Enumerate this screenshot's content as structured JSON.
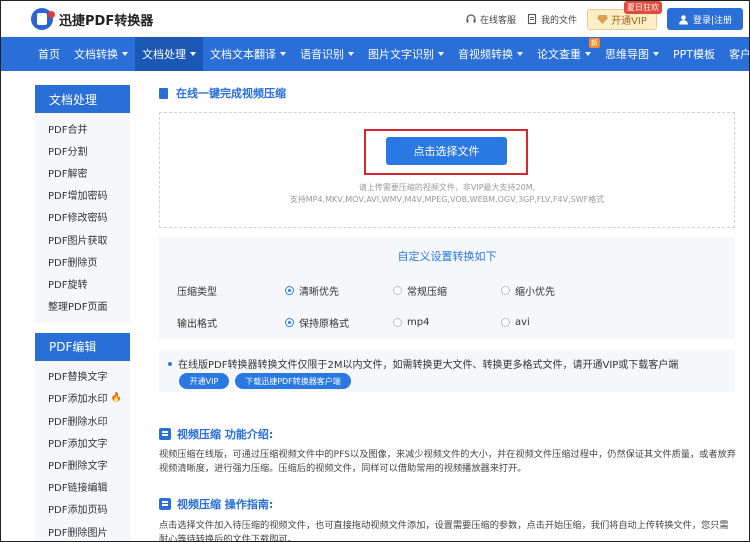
{
  "header": {
    "brand": "迅捷PDF转换器",
    "service": "在线客服",
    "my_files": "我的文件",
    "vip": "开通VIP",
    "vip_badge": "夏日狂欢",
    "login": "登录|注册"
  },
  "nav": {
    "items": [
      {
        "label": "首页",
        "caret": false
      },
      {
        "label": "文档转换",
        "caret": true
      },
      {
        "label": "文档处理",
        "caret": true,
        "active": true
      },
      {
        "label": "文档文本翻译",
        "caret": true
      },
      {
        "label": "语音识别",
        "caret": true
      },
      {
        "label": "图片文字识别",
        "caret": true
      },
      {
        "label": "音视频转换",
        "caret": true
      },
      {
        "label": "论文查重",
        "caret": true,
        "badge": "新"
      },
      {
        "label": "思维导图",
        "caret": true
      },
      {
        "label": "PPT模板",
        "caret": false
      },
      {
        "label": "客户端",
        "caret": true
      }
    ]
  },
  "sidebar": {
    "group1_title": "文档处理",
    "group1_items": [
      "PDF合并",
      "PDF分割",
      "PDF解密",
      "PDF增加密码",
      "PDF修改密码",
      "PDF图片获取",
      "PDF删除页",
      "PDF旋转",
      "整理PDF页面"
    ],
    "group2_title": "PDF编辑",
    "group2_items": [
      "PDF替换文字",
      "PDF添加水印",
      "PDF删除水印",
      "PDF添加文字",
      "PDF删除文字",
      "PDF链接编辑",
      "PDF添加页码",
      "PDF删除图片"
    ]
  },
  "main": {
    "title": "在线一键完成视频压缩",
    "choose_file": "点击选择文件",
    "hint_line1": "请上传需要压缩的视频文件，非VIP最大支持20M,",
    "hint_line2": "支持MP4,MKV,MOV,AVI,WMV,M4V,MPEG,VOB,WEBM,OGV,3GP,FLV,F4V,SWF格式",
    "settings_title": "自定义设置转换如下",
    "compress_label": "压缩类型",
    "compress_options": [
      "清晰优先",
      "常规压缩",
      "缩小优先"
    ],
    "format_label": "输出格式",
    "format_options": [
      "保持原格式",
      "mp4",
      "avi"
    ],
    "notice": "在线版PDF转换器转换文件仅限于2M以内文件，如需转换更大文件、转换更多格式文件，请开通VIP或下载客户端",
    "open_vip": "开通VIP",
    "download_client": "下载迅捷PDF转换器客户端",
    "intro_title": "视频压缩 功能介绍:",
    "intro_text": "视频压缩在线版，可通过压缩视频文件中的PFS以及图像，来减少视频文件的大小，并在视频文件压缩过程中，仍然保证其文件质量，或者放弃视频清晰度，进行强力压缩。压缩后的视频文件，同样可以借助常用的视频播放器来打开。",
    "guide_title": "视频压缩 操作指南:",
    "guide_text": "点击选择文件加入待压缩的视频文件，也可直接拖动视频文件添加，设置需要压缩的参数，点击开始压缩，我们将自动上传转换文件，您只需耐心等待转换后的文件下载即可。"
  }
}
